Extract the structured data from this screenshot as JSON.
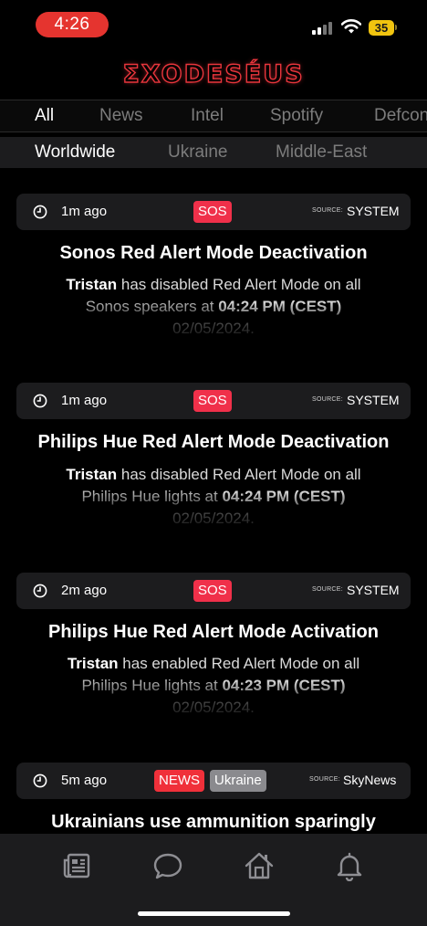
{
  "status_bar": {
    "time": "4:26",
    "battery": "35"
  },
  "app": {
    "logo": "ΣXODESÉUS"
  },
  "tabs": [
    {
      "label": "All",
      "active": true
    },
    {
      "label": "News",
      "active": false
    },
    {
      "label": "Intel",
      "active": false
    },
    {
      "label": "Spotify",
      "active": false
    },
    {
      "label": "Defcon",
      "active": false
    }
  ],
  "regions": [
    {
      "label": "Worldwide",
      "active": true
    },
    {
      "label": "Ukraine",
      "active": false
    },
    {
      "label": "Middle-East",
      "active": false
    }
  ],
  "source_label": "SOURCE:",
  "feed": [
    {
      "time": "1m ago",
      "tags": [
        "SOS"
      ],
      "source": "SYSTEM",
      "title": "Sonos Red Alert Mode Deactivation",
      "user": "Tristan",
      "text1": " has disabled Red Alert Mode on all",
      "text2": "Sonos speakers at ",
      "time_strong": "04:24 PM (CEST)",
      "date": "02/05/2024."
    },
    {
      "time": "1m ago",
      "tags": [
        "SOS"
      ],
      "source": "SYSTEM",
      "title": "Philips Hue Red Alert Mode Deactivation",
      "user": "Tristan",
      "text1": " has disabled Red Alert Mode on all",
      "text2": "Philips Hue lights at ",
      "time_strong": "04:24 PM (CEST)",
      "date": "02/05/2024."
    },
    {
      "time": "2m ago",
      "tags": [
        "SOS"
      ],
      "source": "SYSTEM",
      "title": "Philips Hue Red Alert Mode Activation",
      "user": "Tristan",
      "text1": " has enabled Red Alert Mode on all",
      "text2": "Philips Hue lights at ",
      "time_strong": "04:23 PM (CEST)",
      "date": "02/05/2024."
    },
    {
      "time": "5m ago",
      "tags": [
        "NEWS",
        "Ukraine"
      ],
      "source": "SkyNews",
      "title": "Ukrainians use ammunition sparingly"
    }
  ],
  "bottom_nav": [
    {
      "icon": "news-icon"
    },
    {
      "icon": "chat-icon"
    },
    {
      "icon": "home-icon"
    },
    {
      "icon": "bell-icon"
    }
  ]
}
